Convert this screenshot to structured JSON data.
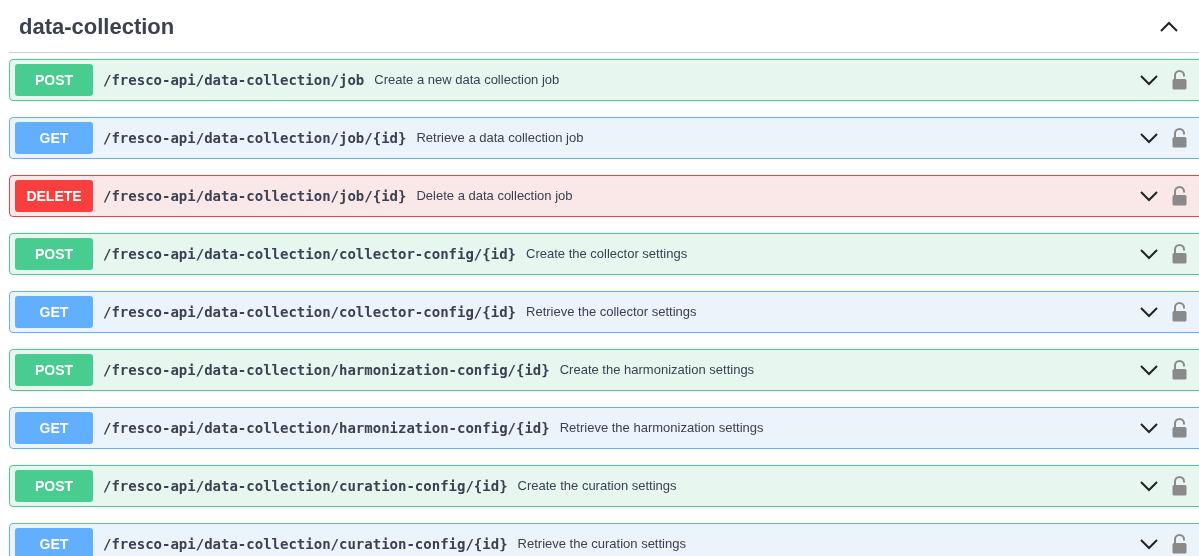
{
  "section": {
    "title": "data-collection",
    "expanded": true
  },
  "operations": [
    {
      "kind": "post",
      "method": "POST",
      "path": "/fresco-api/data-collection/job",
      "summary": "Create a new data collection job"
    },
    {
      "kind": "get",
      "method": "GET",
      "path": "/fresco-api/data-collection/job/{id}",
      "summary": "Retrieve a data collection job"
    },
    {
      "kind": "delete",
      "method": "DELETE",
      "path": "/fresco-api/data-collection/job/{id}",
      "summary": "Delete a data collection job"
    },
    {
      "kind": "post",
      "method": "POST",
      "path": "/fresco-api/data-collection/collector-config/{id}",
      "summary": "Create the collector settings"
    },
    {
      "kind": "get",
      "method": "GET",
      "path": "/fresco-api/data-collection/collector-config/{id}",
      "summary": "Retrieve the collector settings"
    },
    {
      "kind": "post",
      "method": "POST",
      "path": "/fresco-api/data-collection/harmonization-config/{id}",
      "summary": "Create the harmonization settings"
    },
    {
      "kind": "get",
      "method": "GET",
      "path": "/fresco-api/data-collection/harmonization-config/{id}",
      "summary": "Retrieve the harmonization settings"
    },
    {
      "kind": "post",
      "method": "POST",
      "path": "/fresco-api/data-collection/curation-config/{id}",
      "summary": "Create the curation settings"
    },
    {
      "kind": "get",
      "method": "GET",
      "path": "/fresco-api/data-collection/curation-config/{id}",
      "summary": "Retrieve the curation settings"
    }
  ]
}
